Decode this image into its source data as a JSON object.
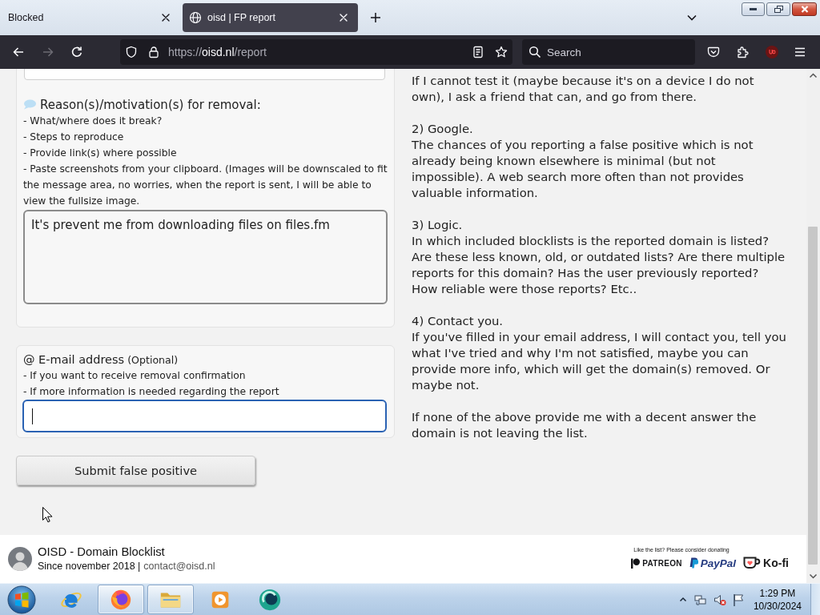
{
  "tabs": [
    {
      "title": "Blocked",
      "selected": false
    },
    {
      "title": "oisd | FP report",
      "selected": true
    }
  ],
  "toolbar": {
    "nav_buttons": [
      {
        "kind": "back",
        "disabled": false
      },
      {
        "kind": "forward",
        "disabled": true
      },
      {
        "kind": "reload",
        "disabled": false
      }
    ],
    "address": {
      "scheme": "https://",
      "host": "oisd.nl",
      "path": "/report"
    },
    "search": {
      "placeholder": "Search"
    }
  },
  "form": {
    "reason": {
      "label": "Reason(s)/motivation(s) for removal:",
      "hints": [
        "- What/where does it break?",
        "- Steps to reproduce",
        "- Provide link(s) where possible",
        "- Paste screenshots from your clipboard. (Images will be downscaled to fit the message area, no worries, when the report is sent, I will be able to view the fullsize image."
      ],
      "value": "It's prevent me from downloading files on files.fm"
    },
    "email": {
      "label": "@ E-mail address",
      "note": "(Optional)",
      "hints": [
        "- If you want to receive removal confirmation",
        "- If more information is needed regarding the report"
      ],
      "focused": true
    },
    "submit": {
      "label": "Submit false positive"
    }
  },
  "info": {
    "sections": [
      {
        "body": "If I cannot test it (maybe because it's on a device I do not own), I ask a friend that can, and go from there."
      },
      {
        "heading": "2) Google.",
        "body": "The chances of you reporting a false positive which is not already being known elsewhere is minimal (but not impossible). A web search more often than not provides valuable information."
      },
      {
        "heading": "3) Logic.",
        "body": "In which included blocklists is the reported domain is listed? Are these less known, old, or outdated lists? Are there multiple reports for this domain? Has the user previously reported? How reliable were those reports? Etc.."
      },
      {
        "heading": "4) Contact you.",
        "body": "If you've filled in your email address, I will contact you, tell you what I've tried and why I'm not satisfied, maybe you can provide more info, which will get the domain(s) removed. Or maybe not."
      },
      {
        "body": "If none of the above provide me with a decent answer the domain is not leaving the list."
      }
    ]
  },
  "footer": {
    "title": "OISD - Domain Blocklist",
    "since": "Since november 2018 |",
    "contact": "contact@oisd.nl",
    "donate_prompt": "Like the list? Please consider donating",
    "donate_links": [
      {
        "kind": "patreon",
        "label": "PATREON"
      },
      {
        "kind": "paypal",
        "label": "PayPal"
      },
      {
        "kind": "kofi",
        "label": "Ko-fi"
      }
    ]
  },
  "taskbar": {
    "apps": [
      {
        "kind": "ie",
        "running": false
      },
      {
        "kind": "firefox",
        "running": true
      },
      {
        "kind": "explorer",
        "running": true
      },
      {
        "kind": "media",
        "running": false
      },
      {
        "kind": "circle",
        "running": false
      }
    ],
    "clock": {
      "time": "1:29 PM",
      "date": "10/30/2024"
    }
  }
}
